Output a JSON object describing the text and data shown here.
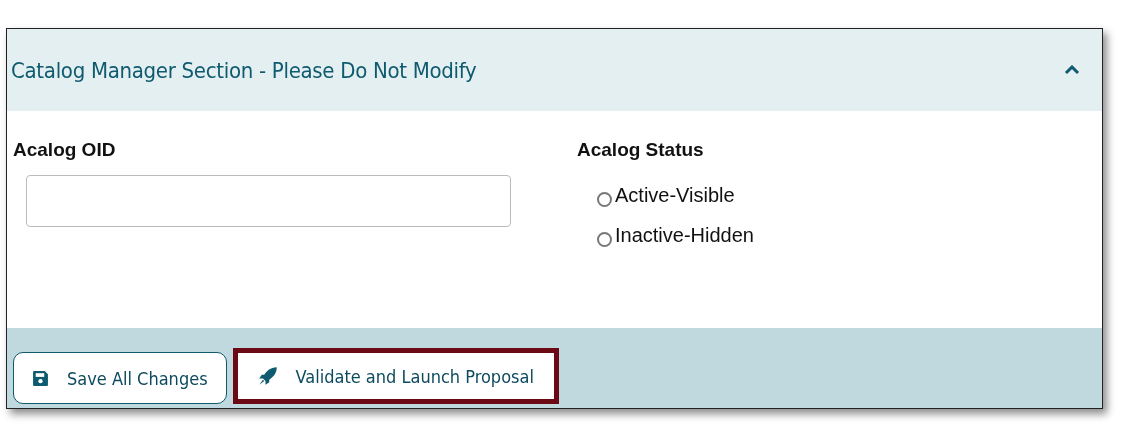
{
  "section": {
    "title": "Catalog Manager Section - Please Do Not Modify",
    "expanded": true
  },
  "oid_field": {
    "label": "Acalog OID"
  },
  "status": {
    "label": "Acalog Status",
    "options": [
      {
        "label": "Active-Visible",
        "selected": false
      },
      {
        "label": "Inactive-Hidden",
        "selected": false
      }
    ]
  },
  "buttons": [
    {
      "kind": "save",
      "label": "Save All Changes",
      "highlighted": false
    },
    {
      "kind": "launch",
      "label": "Validate and Launch Proposal",
      "highlighted": true
    }
  ]
}
